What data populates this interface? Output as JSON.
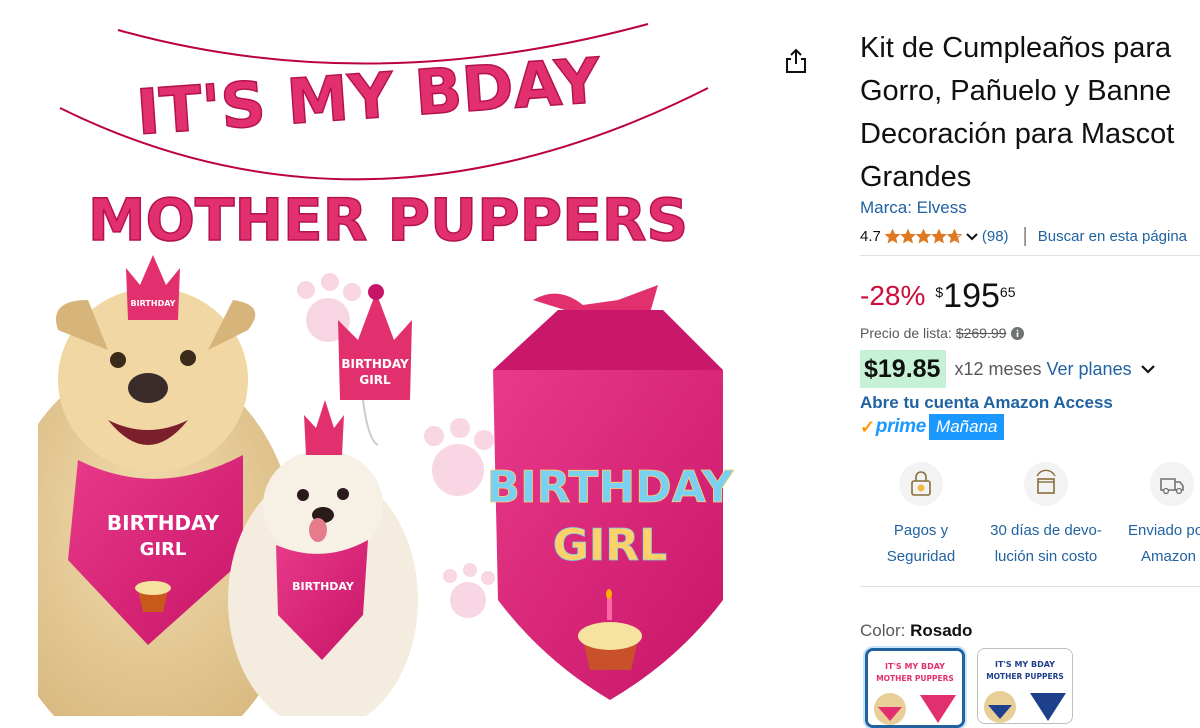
{
  "product": {
    "title_lines": [
      "Kit de Cumpleaños para",
      "Gorro, Pañuelo y Banne",
      "Decoración para Mascot",
      "Grandes"
    ],
    "brand": "Marca: Elvess",
    "rating": "4.7",
    "rating_value": 4.7,
    "review_count": "(98)",
    "search_link": "Buscar en esta página"
  },
  "pricing": {
    "discount": "-28%",
    "currency_symbol": "$",
    "price_whole": "195",
    "price_fraction": "65",
    "list_label": "Precio de lista:",
    "list_price": "$269.99",
    "installment_amount": "$19.85",
    "installment_months": "x12 meses",
    "installment_link": "Ver planes",
    "access_link": "Abre tu cuenta Amazon Access"
  },
  "delivery": {
    "prime_label": "prime",
    "prime_check": "✓",
    "day": "Mañana"
  },
  "features": [
    {
      "line1": "Pagos y",
      "line2": "Seguridad",
      "icon": "secure-payment-icon"
    },
    {
      "line1": "30 días de devo-",
      "line2": "lución sin costo",
      "icon": "return-box-icon"
    },
    {
      "line1": "Enviado po",
      "line2": "Amazon",
      "icon": "delivery-truck-icon"
    }
  ],
  "color": {
    "label": "Color:",
    "selected": "Rosado",
    "swatch_text_line1": "IT'S MY BDAY",
    "swatch_text_line2": "MOTHER PUPPERS"
  },
  "image_text": {
    "banner_line1": "IT'S MY BDAY",
    "banner_line2": "MOTHER PUPPERS",
    "bandana_line1": "BIRTHDAY",
    "bandana_line2": "GIRL",
    "hat_line1": "BIRTHDAY",
    "hat_line2": "GIRL"
  },
  "colors": {
    "link": "#2162a1",
    "discount": "#cc0c39",
    "installment_bg": "#c7f1d7",
    "prime_blue": "#1a98ff",
    "star": "#de7921",
    "bandana_pink": "#e6227a"
  }
}
